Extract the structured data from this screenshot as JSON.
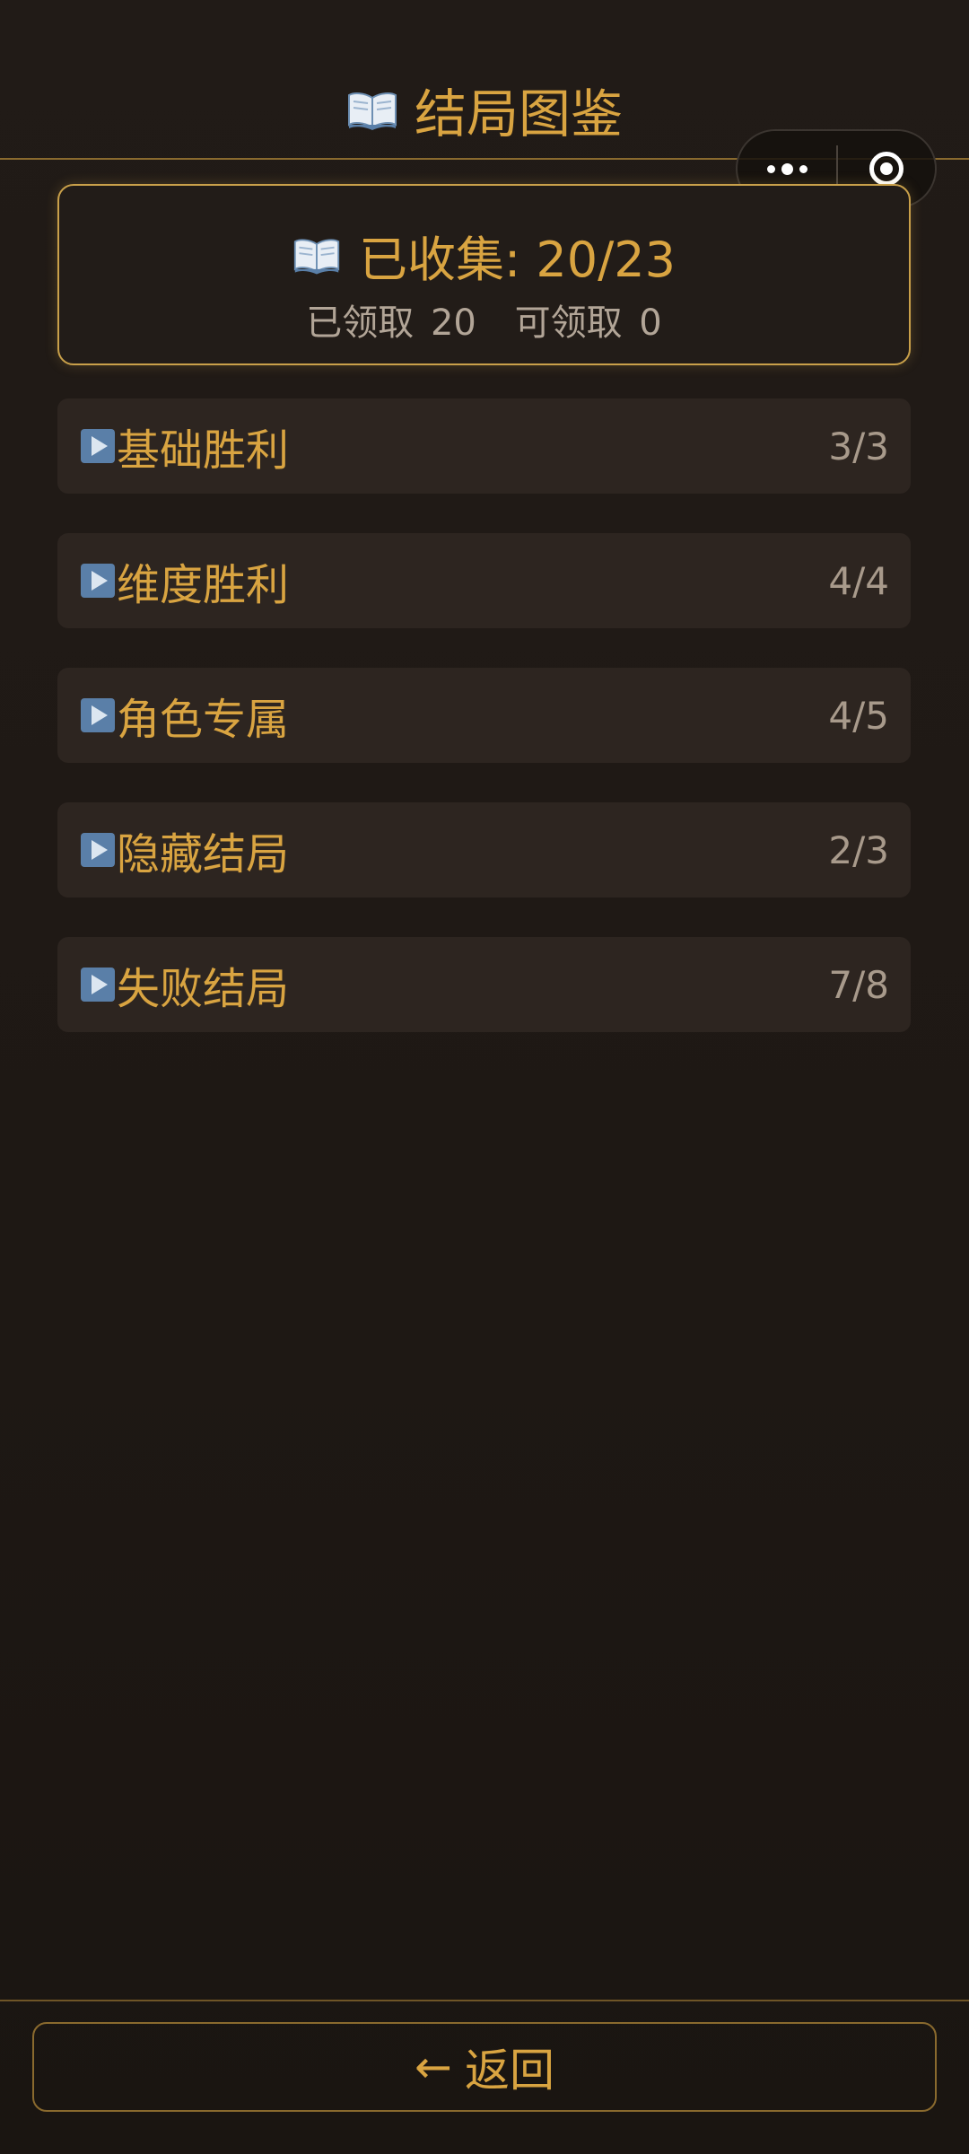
{
  "header": {
    "title": "结局图鉴",
    "icon": "open-book-icon"
  },
  "capsule": {
    "more_icon": "more-dots-icon",
    "close_icon": "target-circle-icon"
  },
  "summary": {
    "collected_label": "已收集: 20/23",
    "claimed_label": "已领取 20",
    "claimable_label": "可领取 0",
    "collected": 20,
    "total": 23
  },
  "categories": [
    {
      "label": "基础胜利",
      "count": "3/3",
      "icon": "play-icon"
    },
    {
      "label": "维度胜利",
      "count": "4/4",
      "icon": "play-icon"
    },
    {
      "label": "角色专属",
      "count": "4/5",
      "icon": "play-icon"
    },
    {
      "label": "隐藏结局",
      "count": "2/3",
      "icon": "play-icon"
    },
    {
      "label": "失败结局",
      "count": "7/8",
      "icon": "play-icon"
    }
  ],
  "footer": {
    "back_arrow": "←",
    "back_label": "返回"
  },
  "colors": {
    "accent": "#d9a441",
    "background": "#1e1814",
    "card": "#2d2520",
    "muted_text": "#a89a8b"
  }
}
